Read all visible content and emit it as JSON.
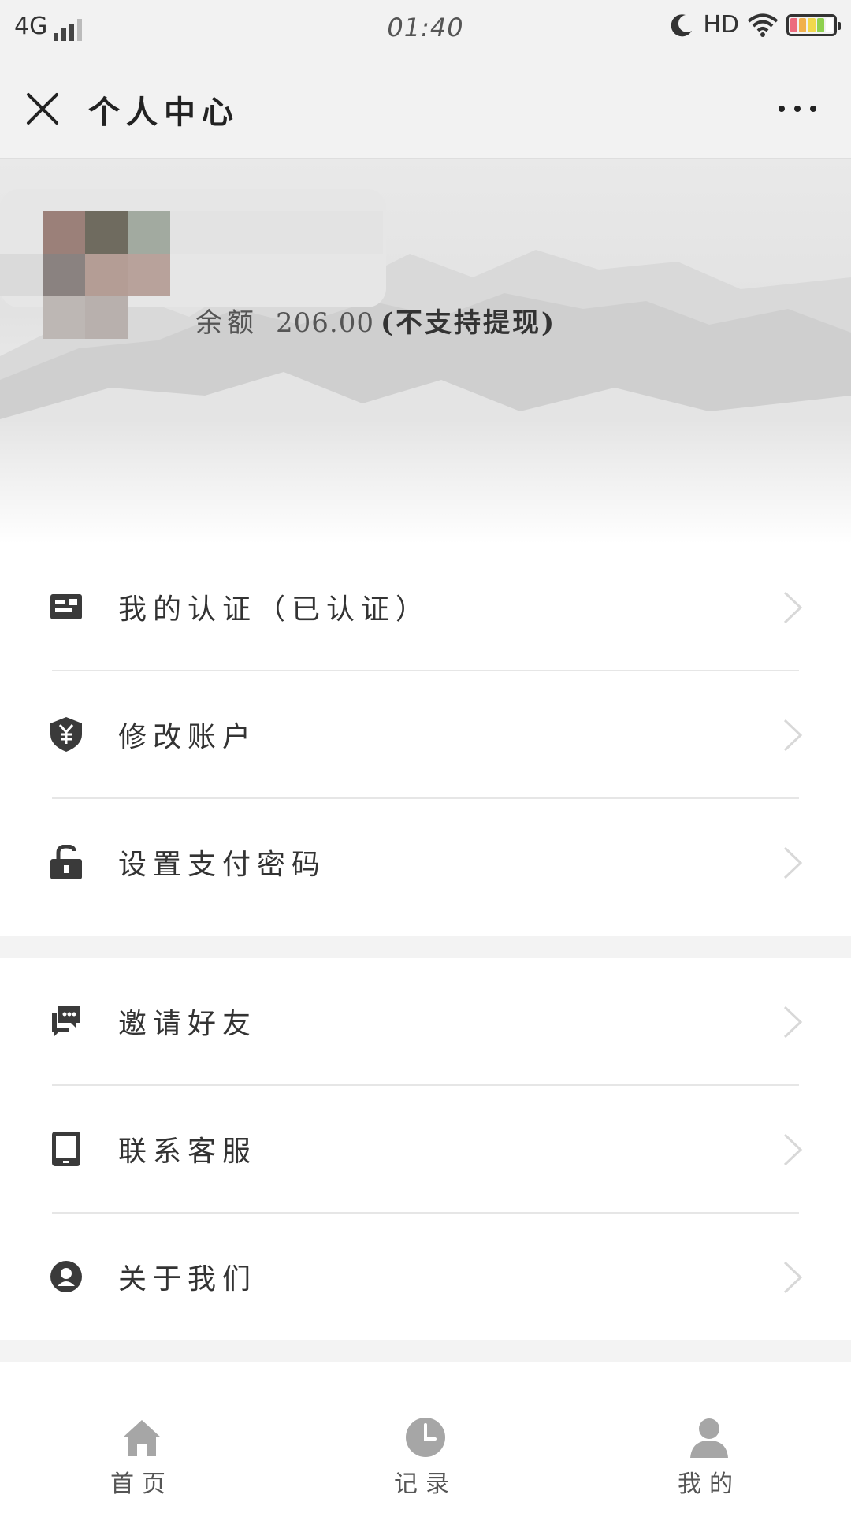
{
  "status_bar": {
    "network": "4G",
    "time": "01:40",
    "hd": "HD",
    "icons": [
      "signal-icon",
      "moon-icon",
      "wifi-icon",
      "battery-icon"
    ]
  },
  "nav": {
    "title": "个人中心",
    "close_icon": "close-icon",
    "more_icon": "more-icon"
  },
  "profile": {
    "avatar": "pixelated-avatar",
    "balance_label": "余额",
    "balance_value": "206.00",
    "balance_note": "(不支持提现)"
  },
  "menu_groups": [
    {
      "items": [
        {
          "label": "我的认证（已认证）",
          "icon": "id-card-icon"
        },
        {
          "label": "修改账户",
          "icon": "yuan-shield-icon"
        },
        {
          "label": "设置支付密码",
          "icon": "unlock-icon"
        }
      ]
    },
    {
      "items": [
        {
          "label": "邀请好友",
          "icon": "chat-bubbles-icon"
        },
        {
          "label": "联系客服",
          "icon": "tablet-icon"
        },
        {
          "label": "关于我们",
          "icon": "user-circle-icon"
        }
      ]
    }
  ],
  "tabs": [
    {
      "label": "首页",
      "icon": "home-icon"
    },
    {
      "label": "记录",
      "icon": "clock-icon"
    },
    {
      "label": "我的",
      "icon": "person-icon"
    }
  ],
  "colors": {
    "background": "#f3f3f3",
    "icon": "#3a3a3a",
    "tab_icon": "#a6a6a6",
    "divider": "#e6e6e6"
  }
}
